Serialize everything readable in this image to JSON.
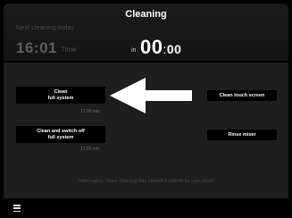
{
  "header": {
    "title": "Cleaning",
    "next_cleaning_label": "Next cleaning today",
    "next_time": "16:01",
    "time_label": "Time",
    "in_label": "in",
    "countdown_hours": "00",
    "countdown_sep": ":",
    "countdown_minutes": "00"
  },
  "buttons": {
    "clean_full_line1": "Clean",
    "clean_full_line2": "full system",
    "clean_full_duration": "17:00 min",
    "clean_touch": "Clean touch screen",
    "clean_off_line1": "Clean and switch off",
    "clean_off_line2": "full system",
    "clean_off_duration": "17:00 min",
    "rinse_mixer": "Rinse mixer"
  },
  "info_text": "Information: Once cleaning has started it cannot be cancelled!",
  "icons": {
    "arrow": "arrow-left-icon",
    "menu": "menu-icon"
  },
  "colors": {
    "background": "#000000",
    "panel": "#1e1e1e",
    "button": "#000000",
    "text": "#ffffff",
    "muted": "#5e5e5e"
  }
}
